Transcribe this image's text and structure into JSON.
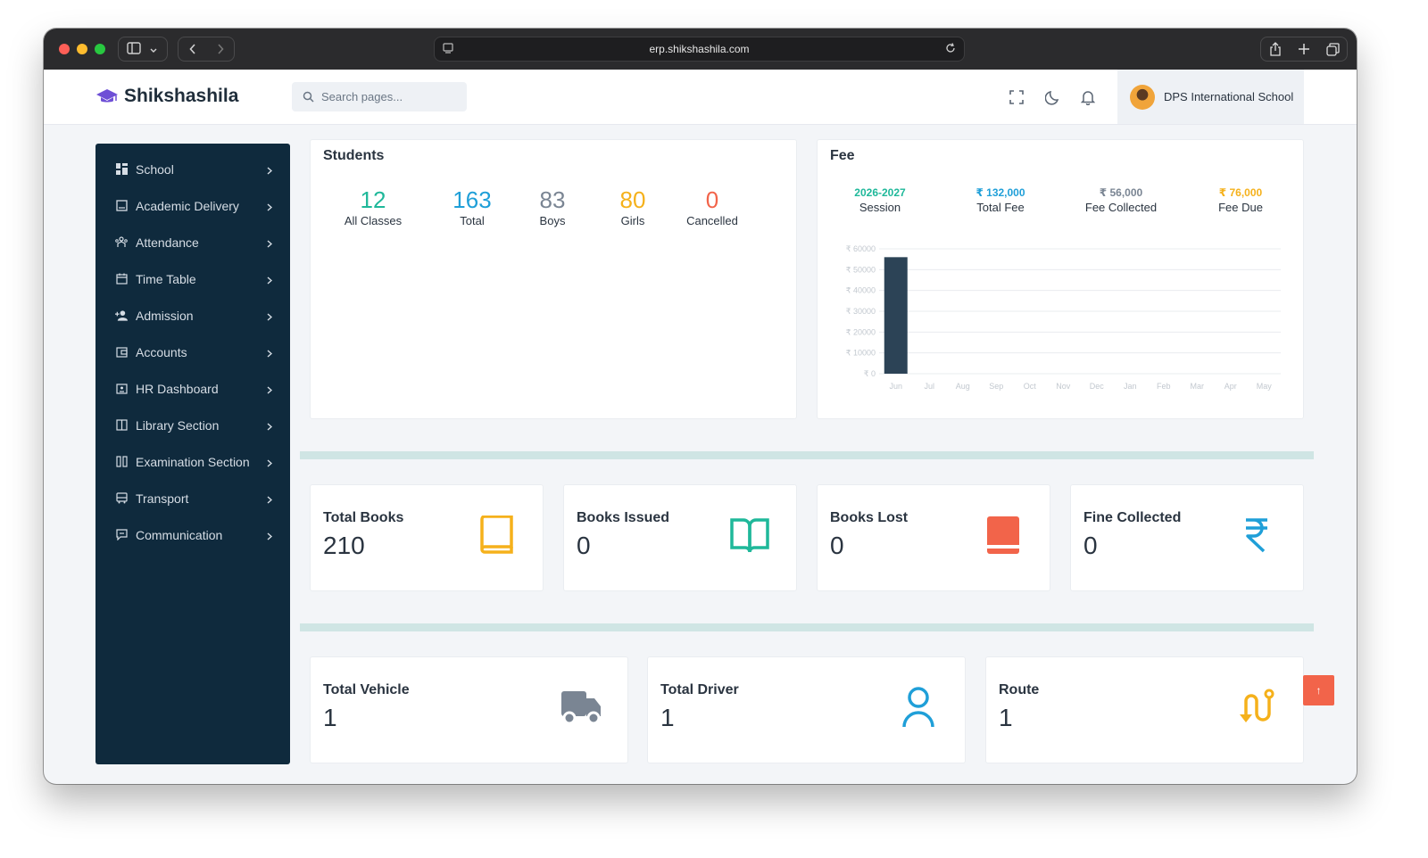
{
  "browser": {
    "url": "erp.shikshashila.com"
  },
  "header": {
    "brand": "Shikshashila",
    "search_placeholder": "Search pages...",
    "school_name": "DPS International School"
  },
  "sidebar": {
    "items": [
      {
        "label": "School",
        "icon": "grid-icon"
      },
      {
        "label": "Academic Delivery",
        "icon": "book-icon"
      },
      {
        "label": "Attendance",
        "icon": "people-icon"
      },
      {
        "label": "Time Table",
        "icon": "calendar-icon"
      },
      {
        "label": "Admission",
        "icon": "add-user-icon"
      },
      {
        "label": "Accounts",
        "icon": "wallet-icon"
      },
      {
        "label": "HR Dashboard",
        "icon": "id-card-icon"
      },
      {
        "label": "Library Section",
        "icon": "library-icon"
      },
      {
        "label": "Examination Section",
        "icon": "exam-icon"
      },
      {
        "label": "Transport",
        "icon": "bus-icon"
      },
      {
        "label": "Communication",
        "icon": "chat-icon"
      }
    ]
  },
  "students": {
    "title": "Students",
    "stats": [
      {
        "value": "12",
        "label": "All Classes",
        "color": "#1fb89a"
      },
      {
        "value": "163",
        "label": "Total",
        "color": "#1f9fd8"
      },
      {
        "value": "83",
        "label": "Boys",
        "color": "#7a8593"
      },
      {
        "value": "80",
        "label": "Girls",
        "color": "#f5b11b"
      },
      {
        "value": "0",
        "label": "Cancelled",
        "color": "#f2644a"
      }
    ]
  },
  "fee": {
    "title": "Fee",
    "stats": [
      {
        "value": "2026-2027",
        "label": "Session",
        "color": "#1fb89a"
      },
      {
        "value": "₹ 132,000",
        "label": "Total Fee",
        "color": "#1f9fd8"
      },
      {
        "value": "₹ 56,000",
        "label": "Fee Collected",
        "color": "#7a8593"
      },
      {
        "value": "₹ 76,000",
        "label": "Fee Due",
        "color": "#f5b11b"
      }
    ]
  },
  "chart_data": {
    "type": "bar",
    "categories": [
      "Jun",
      "Jul",
      "Aug",
      "Sep",
      "Oct",
      "Nov",
      "Dec",
      "Jan",
      "Feb",
      "Mar",
      "Apr",
      "May"
    ],
    "values": [
      56000,
      0,
      0,
      0,
      0,
      0,
      0,
      0,
      0,
      0,
      0,
      0
    ],
    "ylim": [
      0,
      60000
    ],
    "yticks": [
      "₹ 0",
      "₹ 10000",
      "₹ 20000",
      "₹ 30000",
      "₹ 40000",
      "₹ 50000",
      "₹ 60000"
    ],
    "ytick_values": [
      0,
      10000,
      20000,
      30000,
      40000,
      50000,
      60000
    ],
    "bar_color": "#2c4356",
    "grid": true
  },
  "library": [
    {
      "title": "Total Books",
      "value": "210",
      "icon": "book-icon",
      "color": "#f5b11b"
    },
    {
      "title": "Books Issued",
      "value": "0",
      "icon": "open-book-icon",
      "color": "#1fb89a"
    },
    {
      "title": "Books Lost",
      "value": "0",
      "icon": "red-book-icon",
      "color": "#f2644a"
    },
    {
      "title": "Fine Collected",
      "value": "0",
      "icon": "rupee-icon",
      "color": "#1f9fd8"
    }
  ],
  "transport": [
    {
      "title": "Total Vehicle",
      "value": "1",
      "icon": "truck-icon",
      "color": "#7a8593"
    },
    {
      "title": "Total Driver",
      "value": "1",
      "icon": "person-icon",
      "color": "#1f9fd8"
    },
    {
      "title": "Route",
      "value": "1",
      "icon": "route-icon",
      "color": "#f5b11b"
    }
  ],
  "scroll_top_symbol": "↑"
}
